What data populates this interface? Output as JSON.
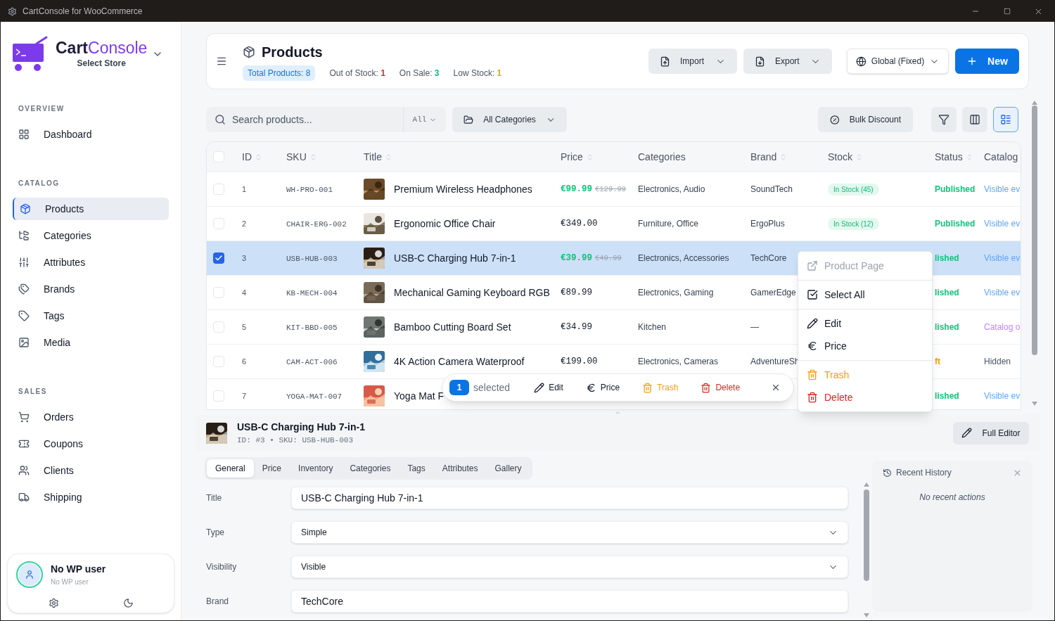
{
  "window": {
    "title": "CartConsole for WooCommerce"
  },
  "brand": {
    "name_bold": "Cart",
    "name_light": "Console",
    "subtitle": "Select Store"
  },
  "nav": [
    {
      "heading": "OVERVIEW",
      "items": [
        {
          "label": "Dashboard",
          "selected": false
        }
      ]
    },
    {
      "heading": "CATALOG",
      "items": [
        {
          "label": "Products",
          "selected": true
        },
        {
          "label": "Categories",
          "selected": false
        },
        {
          "label": "Attributes",
          "selected": false
        },
        {
          "label": "Brands",
          "selected": false
        },
        {
          "label": "Tags",
          "selected": false
        },
        {
          "label": "Media",
          "selected": false
        }
      ]
    },
    {
      "heading": "SALES",
      "items": [
        {
          "label": "Orders",
          "selected": false
        },
        {
          "label": "Coupons",
          "selected": false
        },
        {
          "label": "Clients",
          "selected": false
        },
        {
          "label": "Shipping",
          "selected": false
        }
      ]
    }
  ],
  "user": {
    "name": "No WP user",
    "role": "No WP user"
  },
  "header": {
    "title": "Products",
    "stats": [
      {
        "label": "Total Products:",
        "value": "8",
        "kind": "total"
      },
      {
        "label": "Out of Stock:",
        "value": "1",
        "kind": "danger"
      },
      {
        "label": "On Sale:",
        "value": "3",
        "kind": "success"
      },
      {
        "label": "Low Stock:",
        "value": "1",
        "kind": "warning"
      }
    ],
    "buttons": [
      {
        "label": "Import",
        "kind": "import"
      },
      {
        "label": "Export",
        "kind": "export"
      },
      {
        "label": "Global (Fixed)",
        "kind": "scope"
      },
      {
        "label": "New",
        "kind": "primary"
      }
    ]
  },
  "toolbar": {
    "search": {
      "placeholder": "Search products..."
    },
    "scope": "All",
    "category": "All Categories",
    "bulk": "Bulk Discount",
    "views": [
      {
        "kind": "filter",
        "selected": false
      },
      {
        "kind": "columns",
        "selected": false
      },
      {
        "kind": "list",
        "selected": true
      }
    ]
  },
  "table": {
    "all_selected": false,
    "columns": [
      {
        "label": "ID",
        "sortable": true
      },
      {
        "label": "SKU",
        "sortable": true
      },
      {
        "label": "Title",
        "sortable": true
      },
      {
        "label": "Price",
        "sortable": true
      },
      {
        "label": "Categories",
        "sortable": false
      },
      {
        "label": "Brand",
        "sortable": true
      },
      {
        "label": "Stock",
        "sortable": true
      },
      {
        "label": "Status",
        "sortable": true
      },
      {
        "label": "Catalog",
        "sortable": false
      }
    ],
    "rows": [
      {
        "id": "1",
        "sku": "WH-PRO-001",
        "title": "Premium Wireless Headphones",
        "price": "€99.99",
        "old_price": "€129.99",
        "categories": "Electronics, Audio",
        "brand": "SoundTech",
        "stock": "In Stock (45)",
        "status": {
          "text": "Published",
          "color": "#10c47a"
        },
        "catalog": {
          "text": "Visible ev",
          "color": "#60a5fa"
        },
        "selected": false
      },
      {
        "id": "2",
        "sku": "CHAIR-ERG-002",
        "title": "Ergonomic Office Chair",
        "price": "€349.00",
        "categories": "Furniture, Office",
        "brand": "ErgoPlus",
        "stock": "In Stock (12)",
        "status": {
          "text": "Published",
          "color": "#10c47a"
        },
        "catalog": {
          "text": "Visible ev",
          "color": "#60a5fa"
        },
        "selected": false
      },
      {
        "id": "3",
        "sku": "USB-HUB-003",
        "title": "USB-C Charging Hub 7-in-1",
        "price": "€39.99",
        "old_price": "€49.99",
        "categories": "Electronics, Accessories",
        "brand": "TechCore",
        "status": {
          "text": "lished",
          "color": "#10c47a"
        },
        "catalog": {
          "text": "Visible ev",
          "color": "#60a5fa"
        },
        "selected": true
      },
      {
        "id": "4",
        "sku": "KB-MECH-004",
        "title": "Mechanical Gaming Keyboard RGB",
        "price": "€89.99",
        "categories": "Electronics, Gaming",
        "brand": "GamerEdge",
        "status": {
          "text": "lished",
          "color": "#10c47a"
        },
        "catalog": {
          "text": "Visible ev",
          "color": "#60a5fa"
        },
        "selected": false
      },
      {
        "id": "5",
        "sku": "KIT-BBD-005",
        "title": "Bamboo Cutting Board Set",
        "price": "€34.99",
        "categories": "Kitchen",
        "brand": "—",
        "status": {
          "text": "lished",
          "color": "#10c47a"
        },
        "catalog": {
          "text": "Catalog o",
          "color": "#c084fc"
        },
        "selected": false
      },
      {
        "id": "6",
        "sku": "CAM-ACT-006",
        "title": "4K Action Camera Waterproof",
        "price": "€199.00",
        "categories": "Electronics, Cameras",
        "brand": "AdventureSh",
        "status": {
          "text": "ft",
          "color": "#f59e0b"
        },
        "catalog": {
          "text": "Hidden",
          "color": "#4b5563"
        },
        "selected": false
      },
      {
        "id": "7",
        "sku": "YOGA-MAT-007",
        "title": "Yoga Mat F",
        "status": {
          "text": "lished",
          "color": "#10c47a"
        },
        "catalog": {
          "text": "Visible ev",
          "color": "#60a5fa"
        },
        "selected": false
      }
    ]
  },
  "bulk_bar": {
    "count": "1",
    "label": "selected",
    "actions": [
      {
        "label": "Edit",
        "kind": "edit"
      },
      {
        "label": "Price",
        "kind": "price"
      },
      {
        "label": "Trash",
        "kind": "trash"
      },
      {
        "label": "Delete",
        "kind": "delete"
      }
    ]
  },
  "context_menu": {
    "items": [
      {
        "kind": "link",
        "label": "Product Page",
        "disabled": true
      },
      {
        "kind": "divider"
      },
      {
        "kind": "select_all",
        "label": "Select All",
        "disabled": false
      },
      {
        "kind": "divider"
      },
      {
        "kind": "edit",
        "label": "Edit",
        "disabled": false
      },
      {
        "kind": "price",
        "label": "Price",
        "disabled": false
      },
      {
        "kind": "divider"
      },
      {
        "kind": "trash",
        "label": "Trash",
        "disabled": false
      },
      {
        "kind": "delete",
        "label": "Delete",
        "disabled": false
      }
    ]
  },
  "detail": {
    "title": "USB-C Charging Hub 7-in-1",
    "meta": "ID: #3 • SKU: USB-HUB-003",
    "full_editor": "Full Editor",
    "tabs": [
      {
        "label": "General",
        "selected": true
      },
      {
        "label": "Price",
        "selected": false
      },
      {
        "label": "Inventory",
        "selected": false
      },
      {
        "label": "Categories",
        "selected": false
      },
      {
        "label": "Tags",
        "selected": false
      },
      {
        "label": "Attributes",
        "selected": false
      },
      {
        "label": "Gallery",
        "selected": false
      }
    ],
    "fields": [
      {
        "label": "Title",
        "kind": "text",
        "value": "USB-C Charging Hub 7-in-1"
      },
      {
        "label": "Type",
        "kind": "select",
        "value": "Simple"
      },
      {
        "label": "Visibility",
        "kind": "select",
        "value": "Visible"
      },
      {
        "label": "Brand",
        "kind": "text",
        "value": "TechCore"
      }
    ],
    "history": {
      "title": "Recent History",
      "empty": "No recent actions"
    }
  }
}
